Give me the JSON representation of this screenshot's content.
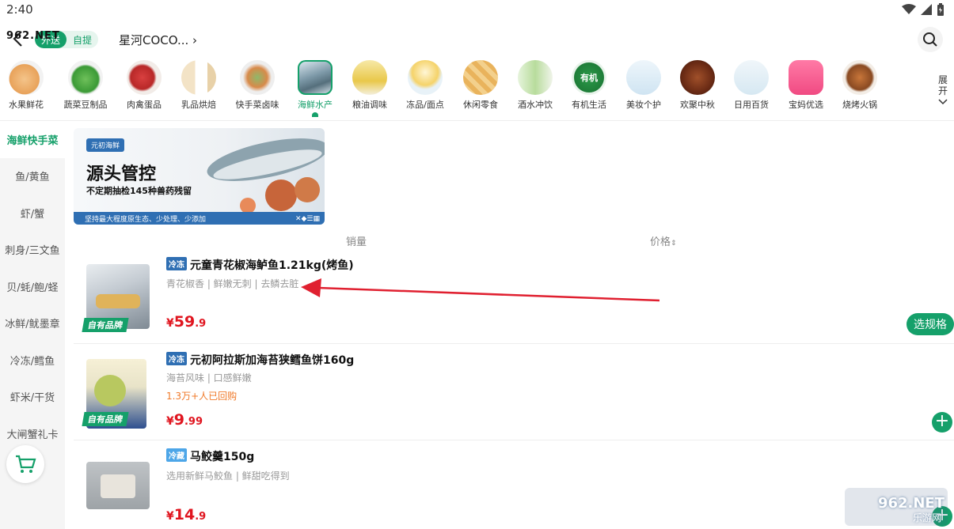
{
  "status": {
    "time": "2:40"
  },
  "header": {
    "mode_on": "外送",
    "mode_off": "自提",
    "store_name": "星河COCO...",
    "watermark": "962.NET"
  },
  "categories": [
    {
      "label": "水果鲜花"
    },
    {
      "label": "蔬菜豆制品"
    },
    {
      "label": "肉禽蛋品"
    },
    {
      "label": "乳品烘焙"
    },
    {
      "label": "快手菜卤味"
    },
    {
      "label": "海鲜水产"
    },
    {
      "label": "粮油调味"
    },
    {
      "label": "冻品/面点"
    },
    {
      "label": "休闲零食"
    },
    {
      "label": "酒水冲饮"
    },
    {
      "label": "有机生活"
    },
    {
      "label": "美妆个护"
    },
    {
      "label": "欢聚中秋"
    },
    {
      "label": "日用百货"
    },
    {
      "label": "宝妈优选"
    },
    {
      "label": "烧烤火锅"
    }
  ],
  "category_icon_text": {
    "organic": "有机"
  },
  "expand_label_1": "展",
  "expand_label_2": "开",
  "sidebar": [
    {
      "label": "海鲜快手菜"
    },
    {
      "label": "鱼/黄鱼"
    },
    {
      "label": "虾/蟹"
    },
    {
      "label": "刺身/三文鱼"
    },
    {
      "label": "贝/蚝/鲍/蛏"
    },
    {
      "label": "冰鲜/鱿墨章"
    },
    {
      "label": "冷冻/鳕鱼"
    },
    {
      "label": "虾米/干货"
    },
    {
      "label": "大闸蟹礼卡"
    }
  ],
  "banner": {
    "tag": "元初海鲜",
    "title": "源头管控",
    "subtitle": "不定期抽检145种兽药残留",
    "footer": "坚持最大程度原生态、少处理、少添加"
  },
  "sort": {
    "sales": "销量",
    "price": "价格"
  },
  "products": [
    {
      "temp": "冷冻",
      "title": "元童青花椒海鲈鱼1.21kg(烤鱼)",
      "desc": "青花椒香 | 鲜嫩无刺 | 去鳞去脏",
      "rebuy": "",
      "price_symbol": "¥",
      "price_int": "59",
      "price_dec": ".9",
      "badge": "自有品牌",
      "action": "选规格"
    },
    {
      "temp": "冷冻",
      "title": "元初阿拉斯加海苔狭鳕鱼饼160g",
      "desc": "海苔风味 | 口感鲜嫩",
      "rebuy": "1.3万+人已回购",
      "price_symbol": "¥",
      "price_int": "9",
      "price_dec": ".99",
      "badge": "自有品牌",
      "action": "+"
    },
    {
      "temp": "冷藏",
      "title": "马鲛羹150g",
      "desc": "选用新鲜马鲛鱼 | 鲜甜吃得到",
      "rebuy": "",
      "price_symbol": "¥",
      "price_int": "14",
      "price_dec": ".9",
      "badge": "",
      "action": "+"
    }
  ],
  "watermark_bottom": {
    "main": "962.NET",
    "sub": "乐游网"
  },
  "colors": {
    "accent": "#15a06a",
    "price": "#e0151f",
    "tag_blue": "#2f6fb3",
    "arrow": "#e02030"
  }
}
